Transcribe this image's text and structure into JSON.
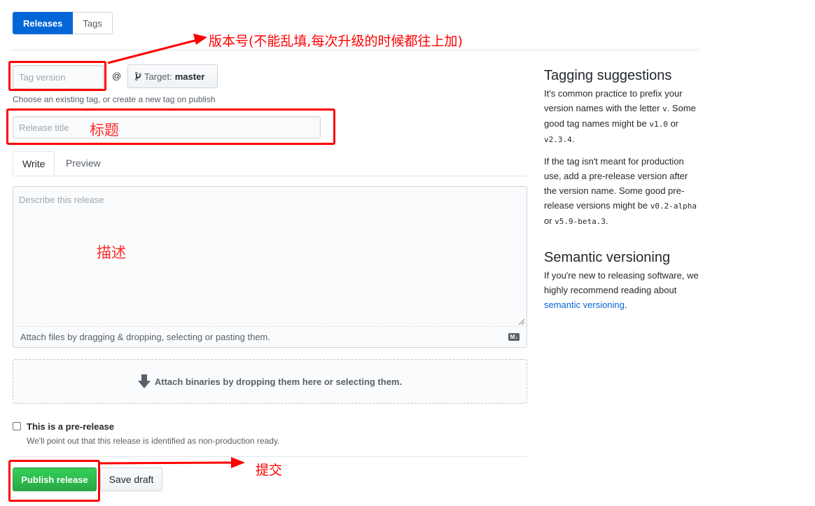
{
  "tabs": {
    "releases": "Releases",
    "tags": "Tags"
  },
  "form": {
    "tag_placeholder": "Tag version",
    "at": "@",
    "target_label": "Target:",
    "target_value": "master",
    "tag_hint": "Choose an existing tag, or create a new tag on publish",
    "title_placeholder": "Release title",
    "write_tab": "Write",
    "preview_tab": "Preview",
    "description_placeholder": "Describe this release",
    "attach_hint": "Attach files by dragging & dropping, selecting or pasting them.",
    "markdown_badge": "M↓",
    "binaries_hint": "Attach binaries by dropping them here or selecting them.",
    "prerelease_label": "This is a pre-release",
    "prerelease_note": "We'll point out that this release is identified as non-production ready.",
    "publish_button": "Publish release",
    "draft_button": "Save draft"
  },
  "sidebar": {
    "tagging_title": "Tagging suggestions",
    "tagging_p1_a": "It's common practice to prefix your version names with the letter ",
    "tagging_p1_v": "v",
    "tagging_p1_b": ". Some good tag names might be ",
    "tagging_p1_c1": "v1.0",
    "tagging_p1_or": " or ",
    "tagging_p1_c2": "v2.3.4",
    "tagging_p1_end": ".",
    "tagging_p2_a": "If the tag isn't meant for production use, add a pre-release version after the version name. Some good pre-release versions might be ",
    "tagging_p2_c1": "v0.2-alpha",
    "tagging_p2_or": " or ",
    "tagging_p2_c2": "v5.9-beta.3",
    "tagging_p2_end": ".",
    "semver_title": "Semantic versioning",
    "semver_p_a": "If you're new to releasing software, we highly recommend reading about ",
    "semver_link": "semantic versioning",
    "semver_p_end": "."
  },
  "annotations": {
    "version": "版本号(不能乱填,每次升级的时候都往上加)",
    "title": "标题",
    "description": "描述",
    "submit": "提交",
    "color": "#ff0000"
  }
}
